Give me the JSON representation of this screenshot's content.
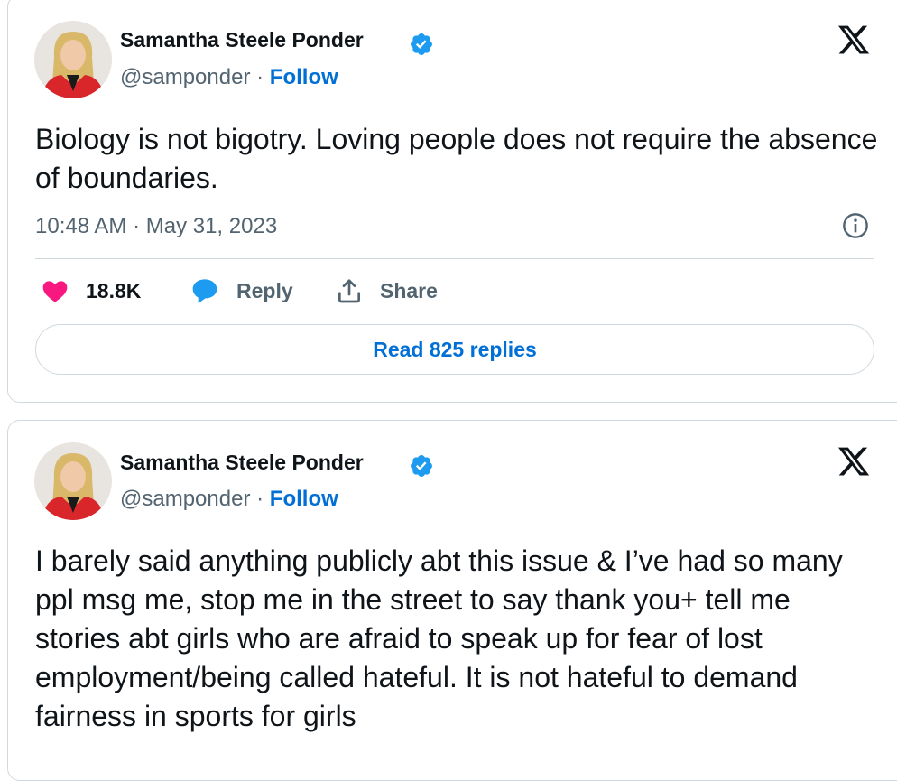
{
  "tweets": [
    {
      "author": {
        "name": "Samantha Steele Ponder",
        "handle": "@samponder",
        "separator": "·",
        "follow_label": "Follow"
      },
      "text": "Biology is not bigotry. Loving people does not require the absence of boundaries.",
      "timestamp": "10:48 AM · May 31, 2023",
      "actions": {
        "likes": "18.8K",
        "reply_label": "Reply",
        "share_label": "Share"
      },
      "read_replies_label": "Read 825 replies"
    },
    {
      "author": {
        "name": "Samantha Steele Ponder",
        "handle": "@samponder",
        "separator": "·",
        "follow_label": "Follow"
      },
      "text": "I barely said anything publicly abt this issue &  I’ve had so many ppl msg me, stop me in the street to say thank you+ tell me stories abt girls who are afraid to speak up for fear of lost employment/being called hateful. It is not hateful to demand fairness in sports for girls"
    }
  ],
  "colors": {
    "accent_blue": "#006fd6",
    "verified_blue": "#1d9bf0",
    "like_pink": "#f91880",
    "secondary_text": "#536471",
    "border": "#cfd9de"
  },
  "icons": [
    "verified-badge-icon",
    "x-logo-icon",
    "info-icon",
    "heart-icon",
    "reply-bubble-icon",
    "share-icon"
  ]
}
